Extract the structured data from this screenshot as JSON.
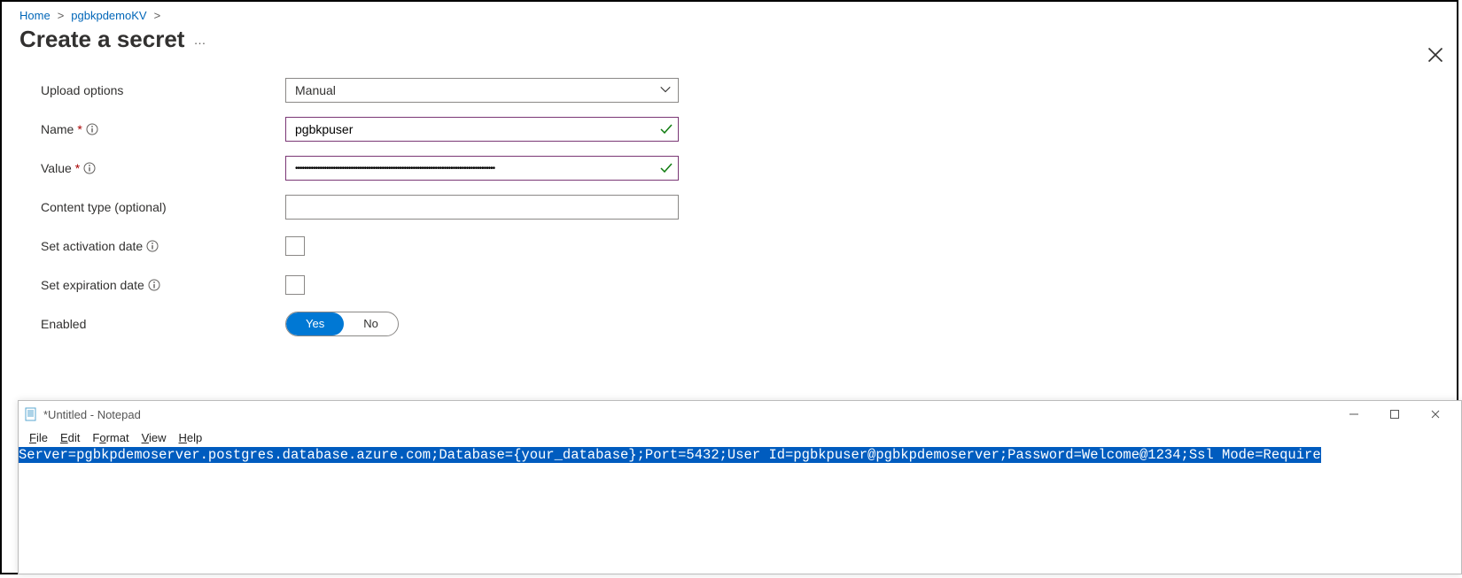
{
  "breadcrumb": {
    "home": "Home",
    "kv": "pgbkpdemoKV"
  },
  "page": {
    "title": "Create a secret",
    "more": "…"
  },
  "form": {
    "upload_label": "Upload options",
    "upload_value": "Manual",
    "name_label": "Name",
    "name_value": "pgbkpuser",
    "value_label": "Value",
    "value_value": "••••••••••••••••••••••••••••••••••••••••••••••••••••••••••••••••••••••••••••••••••••••••••",
    "content_label": "Content type (optional)",
    "content_value": "",
    "activation_label": "Set activation date",
    "expiration_label": "Set expiration date",
    "enabled_label": "Enabled",
    "toggle_yes": "Yes",
    "toggle_no": "No"
  },
  "notepad": {
    "title": "*Untitled - Notepad",
    "menu": {
      "file": "File",
      "edit": "Edit",
      "format": "Format",
      "view": "View",
      "help": "Help"
    },
    "content": "Server=pgbkpdemoserver.postgres.database.azure.com;Database={your_database};Port=5432;User Id=pgbkpuser@pgbkpdemoserver;Password=Welcome@1234;Ssl Mode=Require"
  }
}
